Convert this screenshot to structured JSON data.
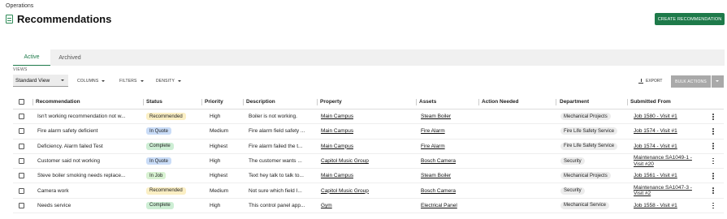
{
  "breadcrumb": "Operations",
  "page_title": "Recommendations",
  "create_button": "CREATE RECOMMENDATION",
  "tabs": [
    {
      "label": "Active",
      "active": true
    },
    {
      "label": "Archived",
      "active": false
    }
  ],
  "toolbar": {
    "views_label": "VIEWS",
    "view_value": "Standard View",
    "columns": "COLUMNS",
    "filters": "FILTERS",
    "density": "DENSITY",
    "export": "EXPORT",
    "bulk_actions": "BULK ACTIONS"
  },
  "colors": {
    "accent": "#1e7a4a",
    "recommended_bg": "#fbefc4",
    "in_quote_bg": "#c9dcf7",
    "complete_bg": "#cdeed4",
    "in_job_bg": "#d8f2d2"
  },
  "table": {
    "columns": [
      "Recommendation",
      "Status",
      "Priority",
      "Description",
      "Property",
      "Assets",
      "Action Needed",
      "Department",
      "Submitted From"
    ],
    "rows": [
      {
        "recommendation": "Isn't working recommendation not w...",
        "status": "Recommended",
        "status_kind": "recommended",
        "priority": "High",
        "description": "Boiler is not working.",
        "property": "Main Campus",
        "assets": "Steam Boiler",
        "action_needed": "",
        "department": "Mechanical Projects",
        "submitted_from": "Job 1580 - Visit #1"
      },
      {
        "recommendation": "Fire alarm safety deficient",
        "status": "In Quote",
        "status_kind": "in_quote",
        "priority": "Medium",
        "description": "Fire alarm field safety ...",
        "property": "Main Campus",
        "assets": "Fire Alarm",
        "action_needed": "",
        "department": "Fire Life Safety Service",
        "submitted_from": "Job 1574 - Visit #1"
      },
      {
        "recommendation": "Deficiency. Alarm failed Test",
        "status": "Complete",
        "status_kind": "complete",
        "priority": "Highest",
        "description": "Fire alarm failed the t...",
        "property": "Main Campus",
        "assets": "Fire Alarm",
        "action_needed": "",
        "department": "Fire Life Safety Service",
        "submitted_from": "Job 1574 - Visit #1"
      },
      {
        "recommendation": "Customer said not working",
        "status": "In Quote",
        "status_kind": "in_quote",
        "priority": "High",
        "description": "The customer wants ...",
        "property": "Capitol Music Group",
        "assets": "Bosch Camera",
        "action_needed": "",
        "department": "Security",
        "submitted_from": "Maintenance SA1049-1 - Visit #20"
      },
      {
        "recommendation": "Steve boiler smoking needs replace...",
        "status": "In Job",
        "status_kind": "in_job",
        "priority": "Highest",
        "description": "Text hey talk to talk to...",
        "property": "Main Campus",
        "assets": "Steam Boiler",
        "action_needed": "",
        "department": "Mechanical Projects",
        "submitted_from": "Job 1561 - Visit #1"
      },
      {
        "recommendation": "Camera work",
        "status": "Recommended",
        "status_kind": "recommended",
        "priority": "Medium",
        "description": "Not sure which field I...",
        "property": "Capitol Music Group",
        "assets": "Bosch Camera",
        "action_needed": "",
        "department": "Security",
        "submitted_from": "Maintenance SA1047-3 - Visit #2"
      },
      {
        "recommendation": "Needs service",
        "status": "Complete",
        "status_kind": "complete",
        "priority": "High",
        "description": "This control panel app...",
        "property": "Gym",
        "assets": "Electrical Panel",
        "action_needed": "",
        "department": "Mechanical Service",
        "submitted_from": "Job 1558 - Visit #1"
      }
    ]
  }
}
